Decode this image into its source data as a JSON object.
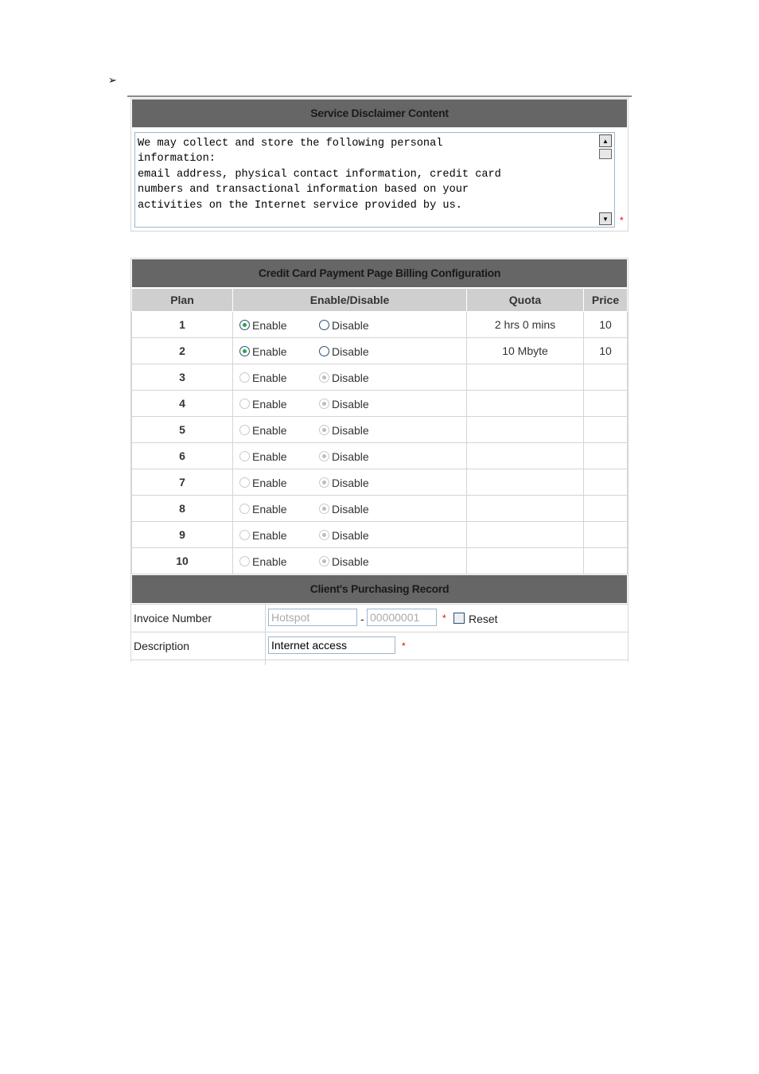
{
  "bullet": "➢",
  "disclaimer": {
    "title": "Service Disclaimer Content",
    "text": "We may collect and store the following personal\ninformation:\nemail address, physical contact information, credit card\nnumbers and transactional information based on your\nactivities on the Internet service provided by us.",
    "required_mark": "*"
  },
  "billing": {
    "title": "Credit Card Payment Page Billing Configuration",
    "columns": [
      "Plan",
      "Enable/Disable",
      "Quota",
      "Price"
    ],
    "enable_label": "Enable",
    "disable_label": "Disable",
    "plans": [
      {
        "plan": "1",
        "enabled": true,
        "editable": true,
        "quota": "2 hrs 0 mins",
        "price": "10"
      },
      {
        "plan": "2",
        "enabled": true,
        "editable": true,
        "quota": "10 Mbyte",
        "price": "10"
      },
      {
        "plan": "3",
        "enabled": false,
        "editable": false,
        "quota": "",
        "price": ""
      },
      {
        "plan": "4",
        "enabled": false,
        "editable": false,
        "quota": "",
        "price": ""
      },
      {
        "plan": "5",
        "enabled": false,
        "editable": false,
        "quota": "",
        "price": ""
      },
      {
        "plan": "6",
        "enabled": false,
        "editable": false,
        "quota": "",
        "price": ""
      },
      {
        "plan": "7",
        "enabled": false,
        "editable": false,
        "quota": "",
        "price": ""
      },
      {
        "plan": "8",
        "enabled": false,
        "editable": false,
        "quota": "",
        "price": ""
      },
      {
        "plan": "9",
        "enabled": false,
        "editable": false,
        "quota": "",
        "price": ""
      },
      {
        "plan": "10",
        "enabled": false,
        "editable": false,
        "quota": "",
        "price": ""
      }
    ]
  },
  "purchasing": {
    "title": "Client's Purchasing Record",
    "invoice_label": "Invoice Number",
    "invoice_prefix": "Hotspot",
    "invoice_separator": "-",
    "invoice_number": "00000001",
    "required_mark": "*",
    "reset_label": "Reset",
    "reset_checked": false,
    "description_label": "Description",
    "description_value": "Internet access"
  }
}
